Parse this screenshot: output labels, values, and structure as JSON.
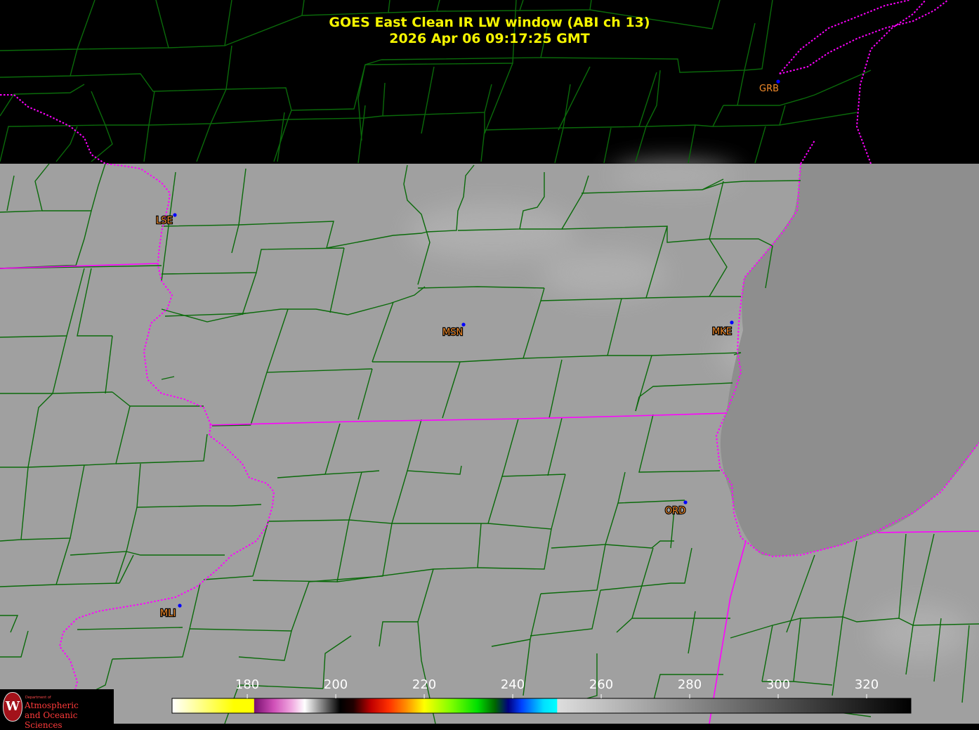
{
  "title": {
    "line1": "GOES East Clean IR LW window (ABI ch 13)",
    "line2": "2026 Apr 06  09:17:25 GMT"
  },
  "stations": [
    {
      "id": "GRB"
    },
    {
      "id": "LSE"
    },
    {
      "id": "MSN"
    },
    {
      "id": "MKE"
    },
    {
      "id": "ORD"
    },
    {
      "id": "MLI"
    }
  ],
  "colorbar": {
    "ticks": [
      "180",
      "200",
      "220",
      "240",
      "260",
      "280",
      "300",
      "320"
    ],
    "min": 163,
    "max": 330,
    "stops": [
      {
        "v": 163,
        "c": "#ffffff"
      },
      {
        "v": 177,
        "c": "#ffff00"
      },
      {
        "v": 181.5,
        "c": "#ffff00"
      },
      {
        "v": 181.6,
        "c": "#7a1070"
      },
      {
        "v": 186,
        "c": "#d050b8"
      },
      {
        "v": 190,
        "c": "#f0a8e0"
      },
      {
        "v": 193,
        "c": "#ffffff"
      },
      {
        "v": 201,
        "c": "#000000"
      },
      {
        "v": 204,
        "c": "#200000"
      },
      {
        "v": 208,
        "c": "#c00000"
      },
      {
        "v": 212,
        "c": "#ff3000"
      },
      {
        "v": 216,
        "c": "#ff9000"
      },
      {
        "v": 220,
        "c": "#ffff00"
      },
      {
        "v": 226,
        "c": "#80ff00"
      },
      {
        "v": 232,
        "c": "#00e000"
      },
      {
        "v": 236,
        "c": "#006600"
      },
      {
        "v": 239,
        "c": "#000080"
      },
      {
        "v": 242,
        "c": "#0040ff"
      },
      {
        "v": 247,
        "c": "#00e0ff"
      },
      {
        "v": 250,
        "c": "#00ffff"
      },
      {
        "v": 250.1,
        "c": "#dddddd"
      },
      {
        "v": 330,
        "c": "#000000"
      }
    ]
  },
  "logo": {
    "dept": "Department of",
    "line1": "Atmospheric",
    "line2": "and Oceanic Sciences"
  },
  "colors": {
    "background": "#000000",
    "land": "#a0a0a0",
    "lake": "#8c8c8c",
    "county_lines": "#0a6a0a",
    "state_lines": "#ff00ff",
    "station_dot": "#0000ff",
    "station_label": "#f08a2a",
    "title": "#f5f500"
  }
}
